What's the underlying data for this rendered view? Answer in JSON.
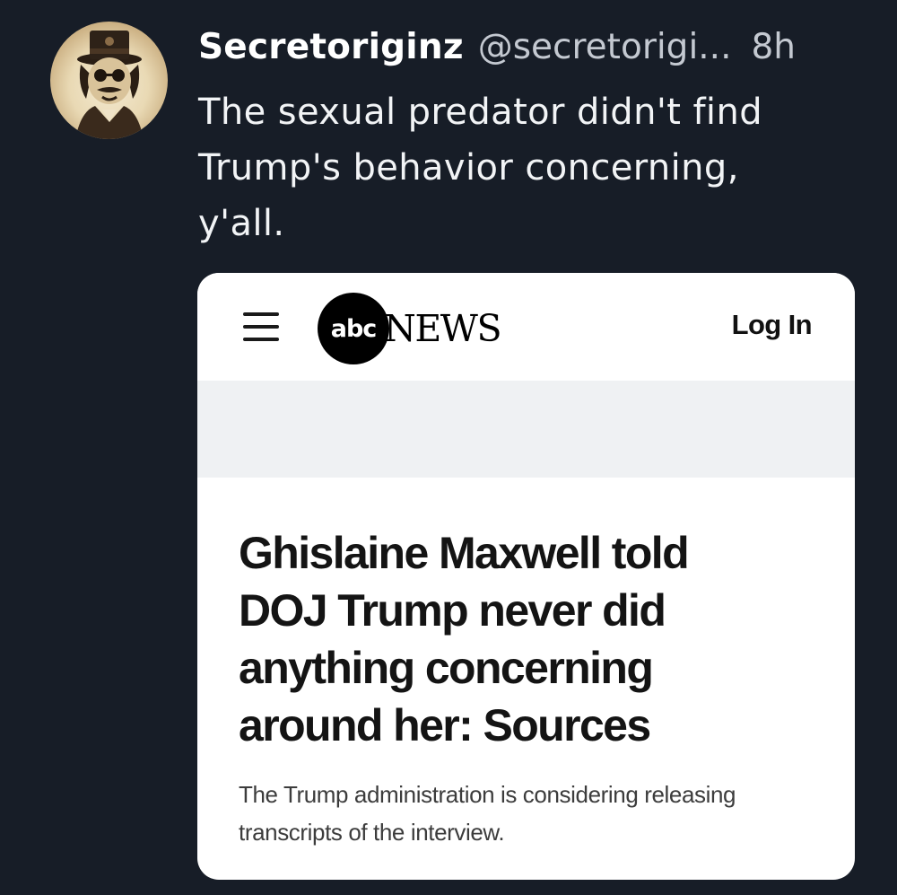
{
  "tweet": {
    "display_name": "Secretoriginz",
    "handle": "@secretorigi...",
    "timestamp": "8h",
    "text": "The sexual predator didn't find\nTrump's behavior concerning,\ny'all.",
    "avatar_icon": "top-hat-figure-avatar"
  },
  "card": {
    "nav": {
      "menu_icon": "hamburger-menu-icon",
      "logo_abc": "abc",
      "logo_news": "NEWS",
      "login_label": "Log In"
    },
    "headline": "Ghislaine Maxwell told\nDOJ Trump never did\nanything concerning\naround her: Sources",
    "subheadline": "The Trump administration is considering releasing\ntranscripts of the interview."
  },
  "colors": {
    "background": "#171d27",
    "card_background": "#ffffff",
    "ad_band": "#eff1f3",
    "secondary_text": "#c4c9d1"
  }
}
